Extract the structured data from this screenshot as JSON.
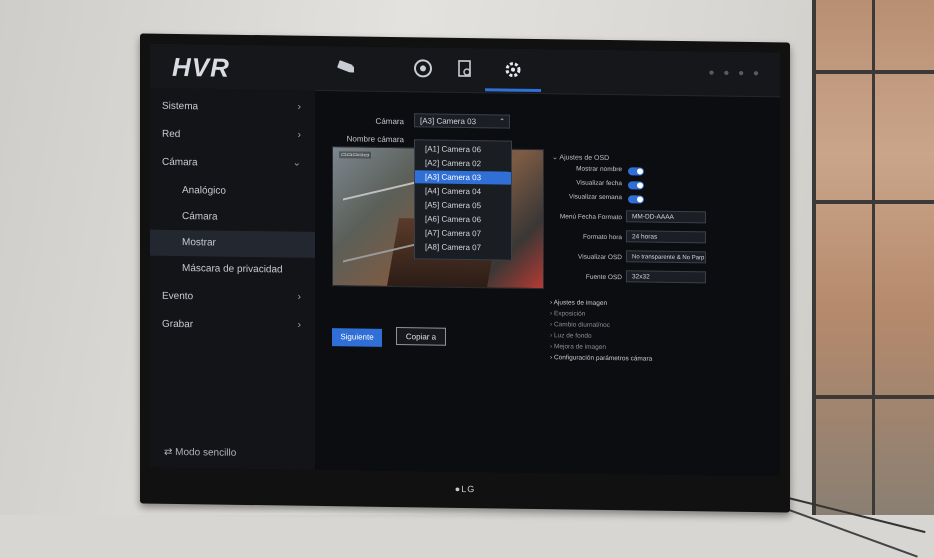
{
  "app": {
    "logo": "HVR"
  },
  "nav": {
    "icons": [
      "camera-icon",
      "playback-icon",
      "search-file-icon",
      "settings-icon"
    ],
    "active": "settings-icon"
  },
  "sidebar": {
    "items": [
      {
        "label": "Sistema",
        "chevron": "›"
      },
      {
        "label": "Red",
        "chevron": "›"
      },
      {
        "label": "Cámara",
        "chevron": "⌄"
      },
      {
        "label": "Analógico",
        "chevron": ""
      },
      {
        "label": "Cámara",
        "chevron": ""
      },
      {
        "label": "Mostrar",
        "chevron": ""
      },
      {
        "label": "Máscara de privacidad",
        "chevron": ""
      },
      {
        "label": "Evento",
        "chevron": "›"
      },
      {
        "label": "Grabar",
        "chevron": "›"
      }
    ],
    "active_index": 5,
    "footer": "⇄ Modo sencillo"
  },
  "form": {
    "camera_label": "Cámara",
    "camera_value": "[A3] Camera 03",
    "camera_name_label": "Nombre cámara",
    "dropdown_options": [
      "[A1] Camera 06",
      "[A2] Camera 02",
      "[A3] Camera 03",
      "[A4] Camera 04",
      "[A5] Camera 05",
      "[A6] Camera 06",
      "[A7] Camera 07",
      "[A8] Camera 07"
    ],
    "selected_option": "[A3] Camera 03"
  },
  "buttons": {
    "next": "Siguiente",
    "copy": "Copiar a"
  },
  "osd": {
    "section": "⌄ Ajustes de OSD",
    "show_name": "Mostrar nombre",
    "show_date": "Visualizar fecha",
    "show_week": "Visualizar semana",
    "date_format_label": "Menú Fecha Formato",
    "date_format_value": "MM-DD-AAAA",
    "time_format_label": "Formato hora",
    "time_format_value": "24 horas",
    "osd_view_label": "Visualizar OSD",
    "osd_view_value": "No transparente & No Parp",
    "font_label": "Fuente OSD",
    "font_value": "32x32"
  },
  "links": [
    "› Ajustes de imagen",
    "› Exposición",
    "› Cambio diurnal/noc",
    "› Luz de fondo",
    "› Mejora de imagen",
    "› Configuración parámetros cámara"
  ],
  "tv_brand": "●LG"
}
